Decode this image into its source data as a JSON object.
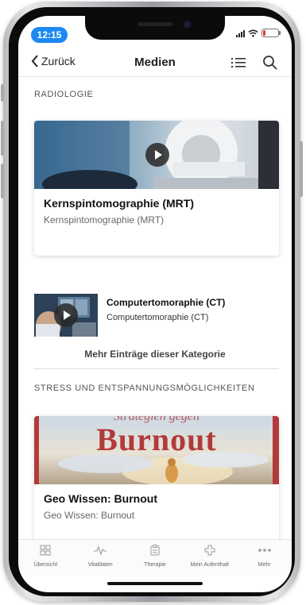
{
  "status_bar": {
    "time": "12:15"
  },
  "navbar": {
    "back_label": "Zurück",
    "title": "Medien"
  },
  "sections": [
    {
      "title": "RADIOLOGIE",
      "featured": {
        "title": "Kernspintomographie (MRT)",
        "subtitle": "Kernspintomographie (MRT)"
      },
      "items": [
        {
          "title": "Computertomoraphie (CT)",
          "subtitle": "Computertomoraphie (CT)"
        }
      ],
      "more_label": "Mehr Einträge dieser Kategorie"
    },
    {
      "title": "STRESS UND ENTSPANNUNGSMÖGLICHKEITEN",
      "featured": {
        "title": "Geo Wissen: Burnout",
        "subtitle": "Geo Wissen: Burnout",
        "image_text": "Burnout",
        "image_text_top": "Strategien gegen"
      }
    }
  ],
  "tabbar": [
    {
      "label": "Übersicht",
      "icon": "grid-icon"
    },
    {
      "label": "Vitaldaten",
      "icon": "pulse-icon"
    },
    {
      "label": "Therapie",
      "icon": "clipboard-icon"
    },
    {
      "label": "Mein Aufenthalt",
      "icon": "medical-cross-icon"
    },
    {
      "label": "Mehr",
      "icon": "more-dots-icon"
    }
  ],
  "colors": {
    "time_pill": "#1e88f5",
    "battery_low": "#e53935",
    "burnout_text": "#b23a3a"
  }
}
